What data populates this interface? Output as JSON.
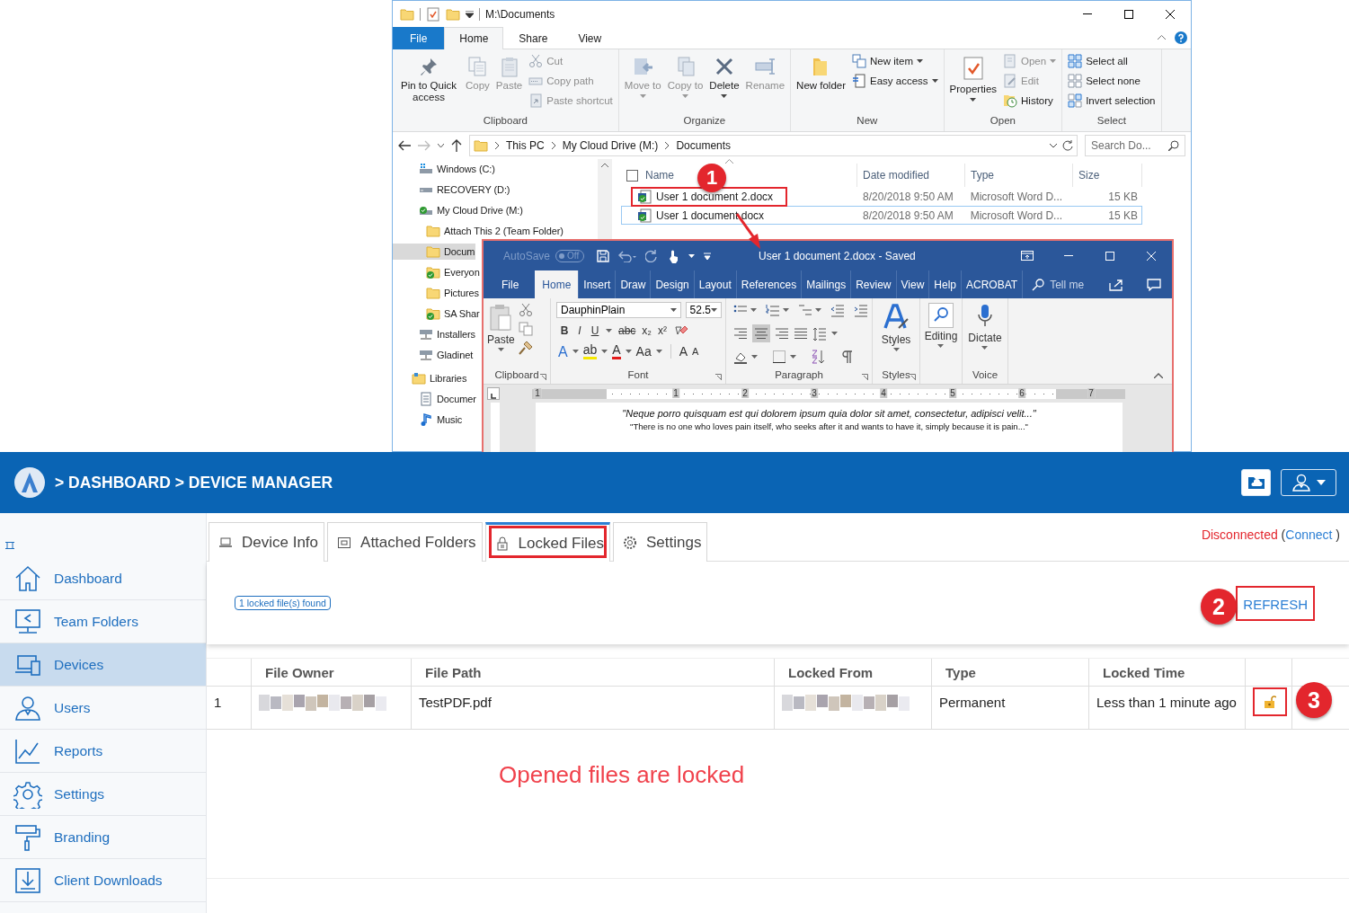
{
  "explorer": {
    "title": "M:\\Documents",
    "tabs": [
      {
        "label": "File",
        "kind": "file",
        "selected": false
      },
      {
        "label": "Home",
        "kind": "tab",
        "selected": true
      },
      {
        "label": "Share",
        "kind": "tab",
        "selected": false
      },
      {
        "label": "View",
        "kind": "tab",
        "selected": false
      }
    ],
    "ribbon_groups": [
      {
        "label": "Clipboard",
        "columns": [
          [
            {
              "label": "Pin to Quick access",
              "kind": "large",
              "disabled": false,
              "dropdown": false
            }
          ],
          [
            {
              "label": "Copy",
              "kind": "large",
              "disabled": true,
              "dropdown": false
            }
          ],
          [
            {
              "label": "Paste",
              "kind": "large",
              "disabled": true,
              "dropdown": false
            }
          ],
          [
            {
              "label": "Cut",
              "kind": "small",
              "disabled": true,
              "dropdown": false
            },
            {
              "label": "Copy path",
              "kind": "small",
              "disabled": true,
              "dropdown": false
            },
            {
              "label": "Paste shortcut",
              "kind": "small",
              "disabled": true,
              "dropdown": false
            }
          ]
        ]
      },
      {
        "label": "Organize",
        "columns": [
          [
            {
              "label": "Move to",
              "kind": "large",
              "disabled": true,
              "dropdown": true
            }
          ],
          [
            {
              "label": "Copy to",
              "kind": "large",
              "disabled": true,
              "dropdown": true
            }
          ],
          [
            {
              "label": "Delete",
              "kind": "large",
              "disabled": false,
              "dropdown": true
            }
          ],
          [
            {
              "label": "Rename",
              "kind": "large",
              "disabled": true,
              "dropdown": false
            }
          ]
        ]
      },
      {
        "label": "New",
        "columns": [
          [
            {
              "label": "New folder",
              "kind": "large",
              "disabled": false,
              "dropdown": false
            }
          ],
          [
            {
              "label": "New item",
              "kind": "small",
              "disabled": false,
              "dropdown": true
            },
            {
              "label": "Easy access",
              "kind": "small",
              "disabled": false,
              "dropdown": true
            }
          ]
        ]
      },
      {
        "label": "Open",
        "columns": [
          [
            {
              "label": "Properties",
              "kind": "large",
              "disabled": false,
              "dropdown": true
            }
          ],
          [
            {
              "label": "Open",
              "kind": "small",
              "disabled": true,
              "dropdown": true
            },
            {
              "label": "Edit",
              "kind": "small",
              "disabled": true,
              "dropdown": false
            },
            {
              "label": "History",
              "kind": "small",
              "disabled": false,
              "dropdown": false
            }
          ]
        ]
      },
      {
        "label": "Select",
        "columns": [
          [
            {
              "label": "Select all",
              "kind": "small",
              "disabled": false,
              "dropdown": false
            },
            {
              "label": "Select none",
              "kind": "small",
              "disabled": false,
              "dropdown": false
            },
            {
              "label": "Invert selection",
              "kind": "small",
              "disabled": false,
              "dropdown": false
            }
          ]
        ]
      }
    ],
    "address": [
      "This PC",
      "My Cloud Drive (M:)",
      "Documents"
    ],
    "search": {
      "placeholder": "Search Do..."
    },
    "nav": [
      {
        "children": [
          {
            "label": "Windows (C:)",
            "kind": "drive_os",
            "selected": false
          },
          {
            "label": "RECOVERY (D:)",
            "kind": "drive",
            "selected": false
          },
          {
            "label": "My Cloud Drive (M:)",
            "kind": "cloud",
            "selected": false,
            "children": [
              {
                "label": "Attach This 2 (Team Folder)",
                "kind": "folder",
                "selected": false
              },
              {
                "label": "Docum",
                "kind": "folder",
                "selected": true
              },
              {
                "label": "Everyon",
                "kind": "synced",
                "selected": false
              },
              {
                "label": "Pictures",
                "kind": "folder",
                "selected": false
              },
              {
                "label": "SA Shar",
                "kind": "synced",
                "selected": false
              }
            ]
          },
          {
            "label": "Installers",
            "kind": "netdrive",
            "selected": false
          },
          {
            "label": "Gladinet",
            "kind": "netdrive",
            "selected": false
          }
        ]
      },
      {
        "label": "Libraries",
        "kind": "library",
        "selected": false,
        "children": [
          {
            "label": "Documer",
            "kind": "doclib",
            "selected": false
          },
          {
            "label": "Music",
            "kind": "music",
            "selected": false
          }
        ]
      }
    ],
    "select_all": {
      "checked": false
    },
    "columns": [
      "Name",
      "Date modified",
      "Type",
      "Size"
    ],
    "files": [
      {
        "name": "User 1 document 2.docx",
        "date": "8/20/2018 9:50 AM",
        "type": "Microsoft Word D...",
        "size": "15 KB",
        "selected": false,
        "highlighted": true
      },
      {
        "name": "User 1 document.docx",
        "date": "8/20/2018 9:50 AM",
        "type": "Microsoft Word D...",
        "size": "15 KB",
        "selected": true,
        "highlighted": false
      }
    ]
  },
  "word": {
    "autosave": "AutoSave",
    "autosave_toggle": {
      "label": "Off",
      "on": false
    },
    "title": "User 1 document 2.docx  -  Saved",
    "tabs": [
      {
        "label": "File",
        "selected": false
      },
      {
        "label": "Home",
        "selected": true
      },
      {
        "label": "Insert",
        "selected": false
      },
      {
        "label": "Draw",
        "selected": false
      },
      {
        "label": "Design",
        "selected": false
      },
      {
        "label": "Layout",
        "selected": false
      },
      {
        "label": "References",
        "selected": false
      },
      {
        "label": "Mailings",
        "selected": false
      },
      {
        "label": "Review",
        "selected": false
      },
      {
        "label": "View",
        "selected": false
      },
      {
        "label": "Help",
        "selected": false
      },
      {
        "label": "ACROBAT",
        "selected": false
      }
    ],
    "tell_me": "Tell me",
    "ribbon": {
      "paste": "Paste",
      "font": "DauphinPlain",
      "size": "52.5",
      "font_buttons": [
        "B",
        "I",
        "U",
        "abc",
        "x₂",
        "x²"
      ],
      "font_buttons_2": [
        "A",
        "ab",
        "A",
        "Aa",
        "A",
        "A"
      ],
      "styles": "Styles",
      "editing": "Editing",
      "dictate": "Dictate",
      "groups": [
        "Clipboard",
        "Font",
        "Paragraph",
        "Styles",
        "Voice"
      ]
    },
    "ruler": [
      "1",
      "1",
      "2",
      "3",
      "4",
      "5",
      "6",
      "7"
    ],
    "document": {
      "lines": [
        "\"Neque porro quisquam est qui dolorem ipsum quia dolor sit amet, consectetur, adipisci velit...\"",
        "\"There is no one who loves pain itself, who seeks after it and wants to have it, simply because it is pain...\""
      ]
    }
  },
  "app": {
    "breadcrumb": "> DASHBOARD > DEVICE MANAGER",
    "sidebar": [
      {
        "label": "Dashboard",
        "selected": false
      },
      {
        "label": "Team Folders",
        "selected": false
      },
      {
        "label": "Devices",
        "selected": true
      },
      {
        "label": "Users",
        "selected": false
      },
      {
        "label": "Reports",
        "selected": false
      },
      {
        "label": "Settings",
        "selected": false
      },
      {
        "label": "Branding",
        "selected": false
      },
      {
        "label": "Client Downloads",
        "selected": false
      }
    ],
    "tabs": [
      {
        "label": "Device Info",
        "selected": false,
        "highlighted": false
      },
      {
        "label": "Attached Folders",
        "selected": false,
        "highlighted": false
      },
      {
        "label": "Locked Files",
        "selected": true,
        "highlighted": true
      },
      {
        "label": "Settings",
        "selected": false,
        "highlighted": false
      }
    ],
    "status": "Disconnected",
    "connect_open": "(",
    "connect": "Connect",
    "connect_close": ")",
    "badge": "1 locked file(s) found",
    "refresh": {
      "label": "REFRESH",
      "highlighted": true
    },
    "table": {
      "columns": [
        {},
        {
          "label": "File Owner"
        },
        {
          "label": "File Path"
        },
        {
          "label": "Locked From"
        },
        {
          "label": "Type"
        },
        {
          "label": "Locked Time"
        },
        {}
      ],
      "rows": [
        {
          "cells": [
            {
              "kind": "text",
              "text": "1"
            },
            {
              "kind": "redacted"
            },
            {
              "kind": "text",
              "text": "TestPDF.pdf"
            },
            {
              "kind": "redacted"
            },
            {
              "kind": "text",
              "text": "Permanent"
            },
            {
              "kind": "text",
              "text": "Less than 1 minute ago"
            },
            {
              "kind": "unlock",
              "highlighted": true
            }
          ]
        }
      ]
    },
    "note": "Opened files are locked"
  },
  "callouts": [
    {
      "label": "1"
    },
    {
      "label": "2"
    },
    {
      "label": "3"
    }
  ]
}
